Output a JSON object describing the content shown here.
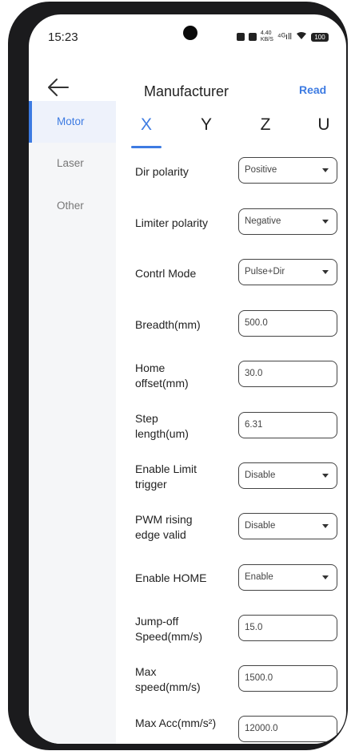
{
  "status_bar": {
    "time": "15:23",
    "network": "4.40\nKB/S",
    "signal": "⁴ᴳıll",
    "battery": "100"
  },
  "header": {
    "title": "Manufacturer",
    "read_label": "Read"
  },
  "sidebar": {
    "items": [
      {
        "label": "Motor",
        "active": true
      },
      {
        "label": "Laser",
        "active": false
      },
      {
        "label": "Other",
        "active": false
      }
    ]
  },
  "tabs": [
    {
      "label": "X",
      "active": true
    },
    {
      "label": "Y",
      "active": false
    },
    {
      "label": "Z",
      "active": false
    },
    {
      "label": "U",
      "active": false
    }
  ],
  "settings": [
    {
      "label": "Dir polarity",
      "type": "select",
      "value": "Positive"
    },
    {
      "label": "Limiter polarity",
      "type": "select",
      "value": "Negative"
    },
    {
      "label": "Contrl Mode",
      "type": "select",
      "value": "Pulse+Dir"
    },
    {
      "label": "Breadth(mm)",
      "type": "input",
      "value": "500.0"
    },
    {
      "label": "Home offset(mm)",
      "type": "input",
      "value": "30.0"
    },
    {
      "label": "Step length(um)",
      "type": "input",
      "value": "6.31"
    },
    {
      "label": "Enable Limit trigger",
      "type": "select",
      "value": "Disable"
    },
    {
      "label": "PWM rising edge valid",
      "type": "select",
      "value": "Disable"
    },
    {
      "label": "Enable HOME",
      "type": "select",
      "value": "Enable"
    },
    {
      "label": "Jump-off Speed(mm/s)",
      "type": "input",
      "value": "15.0"
    },
    {
      "label": "Max speed(mm/s)",
      "type": "input",
      "value": "1500.0"
    },
    {
      "label": "Max Acc(mm/s²)",
      "type": "input",
      "value": "12000.0"
    }
  ],
  "colors": {
    "accent": "#3d7be2",
    "sidebar_bg": "#f5f6f8",
    "frame": "#1b1b1d"
  }
}
